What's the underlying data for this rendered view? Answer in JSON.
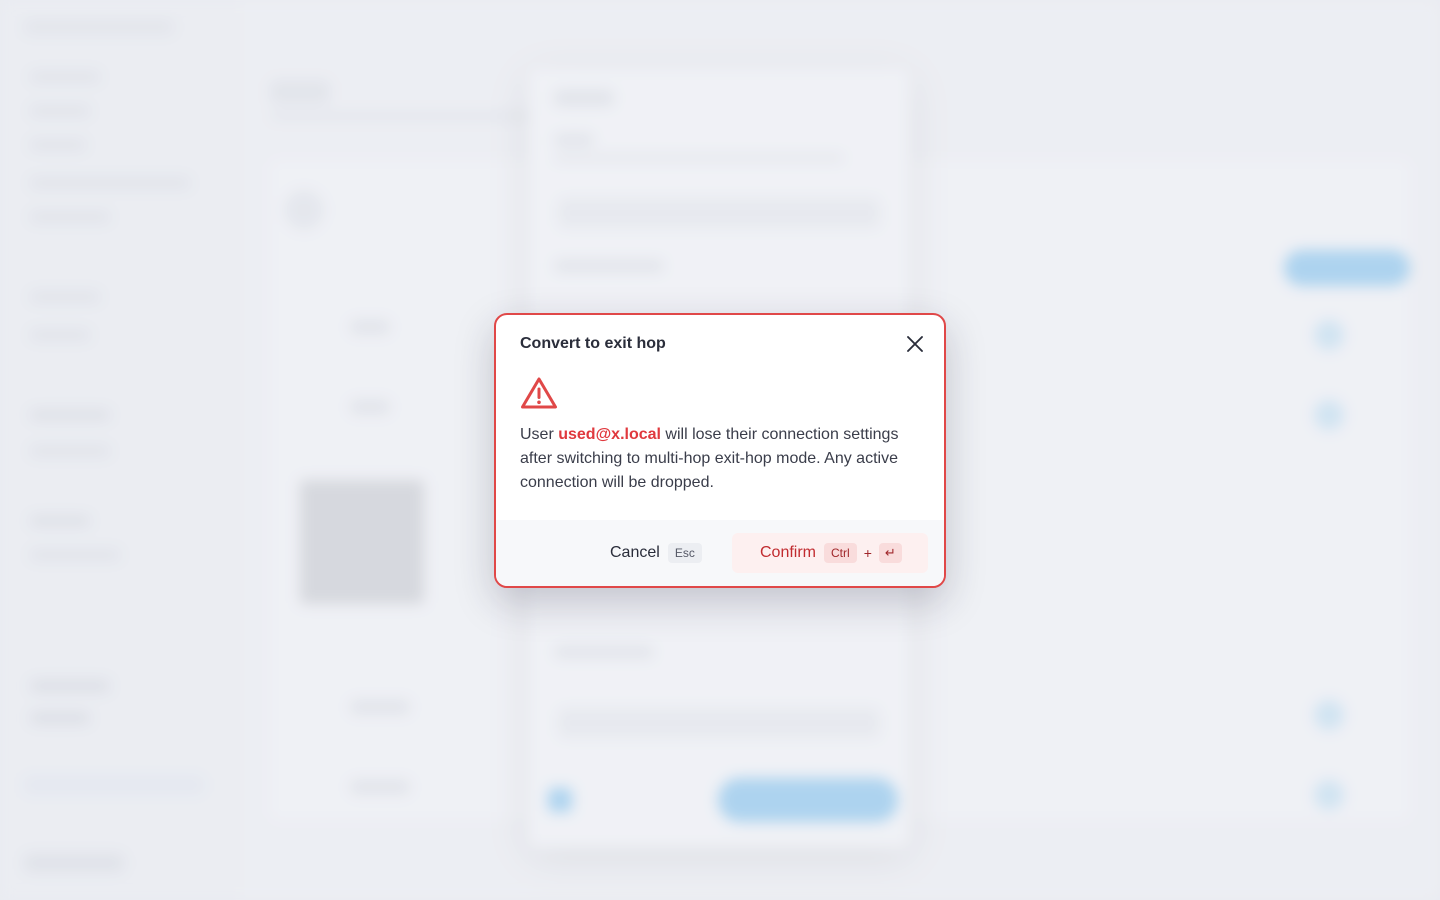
{
  "dialog": {
    "title": "Convert to exit hop",
    "close_icon": "close-icon",
    "warning_icon": "warning-triangle-icon",
    "message": {
      "prefix": "User ",
      "user": "used@x.local",
      "suffix": " will lose their connection settings after switching to multi-hop exit-hop mode. Any active connection will be dropped."
    },
    "cancel": {
      "label": "Cancel",
      "shortcut": "Esc"
    },
    "confirm": {
      "label": "Confirm",
      "shortcut_modifier": "Ctrl",
      "shortcut_plus": "+",
      "shortcut_key": "↵"
    }
  },
  "colors": {
    "danger": "#e04848",
    "danger_text": "#e0393e",
    "confirm_bg": "#fdf0f0"
  }
}
